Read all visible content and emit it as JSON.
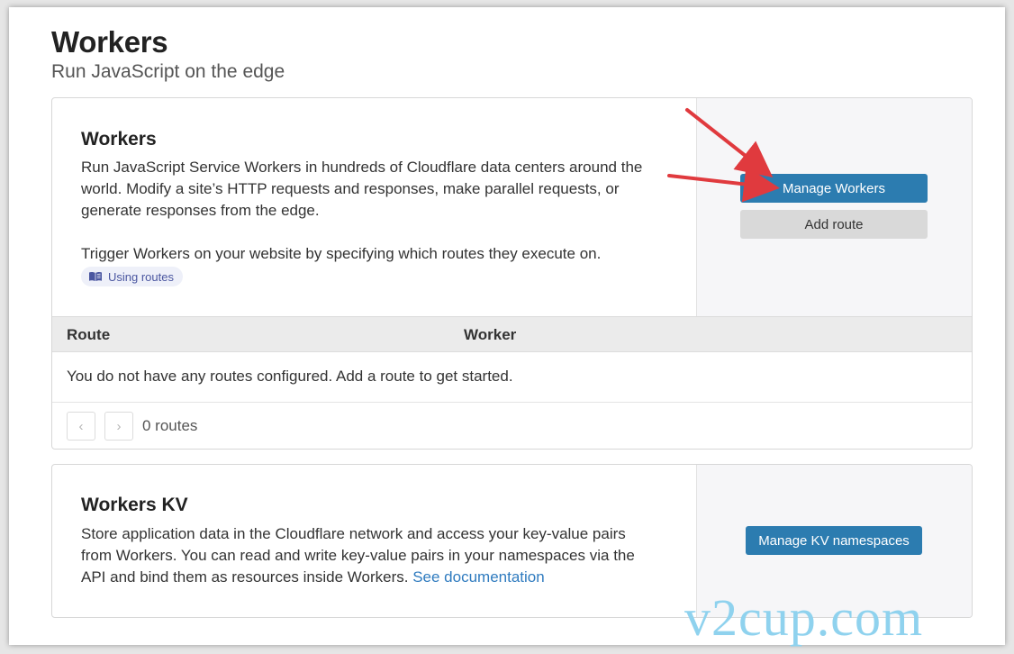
{
  "header": {
    "title": "Workers",
    "subtitle": "Run JavaScript on the edge"
  },
  "workers_card": {
    "title": "Workers",
    "description": "Run JavaScript Service Workers in hundreds of Cloudflare data centers around the world. Modify a site’s HTTP requests and responses, make parallel requests, or generate responses from the edge.",
    "trigger_text": "Trigger Workers on your website by specifying which routes they execute on.",
    "routes_link": "Using routes",
    "manage_button": "Manage Workers",
    "add_route_button": "Add route",
    "table": {
      "columns": [
        "Route",
        "Worker"
      ],
      "empty_message": "You do not have any routes configured. Add a route to get started."
    },
    "pager": {
      "prev_icon": "‹",
      "next_icon": "›",
      "count_label": "0 routes"
    }
  },
  "kv_card": {
    "title": "Workers KV",
    "description": "Store application data in the Cloudflare network and access your key-value pairs from Workers. You can read and write key-value pairs in your namespaces via the API and bind them as resources inside Workers.",
    "doc_link": "See documentation",
    "manage_button": "Manage KV namespaces"
  },
  "watermark": "v2cup.com",
  "colors": {
    "primary_button": "#2c7cb0",
    "annotation_arrow": "#e03a3e",
    "link": "#2f7bbf",
    "watermark": "#8fd2ee"
  },
  "icons": {
    "routes_link": "book-icon",
    "prev": "chevron-left-icon",
    "next": "chevron-right-icon"
  }
}
